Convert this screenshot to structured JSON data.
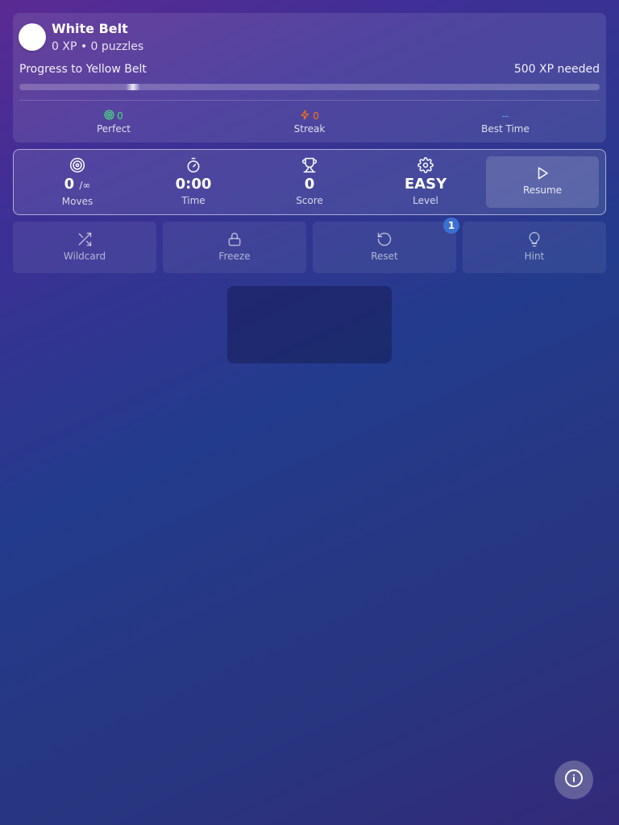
{
  "belt": {
    "title": "White Belt",
    "subtitle": "0 XP • 0 puzzles",
    "avatar_color": "#ffffff",
    "progress_label": "Progress to Yellow Belt",
    "progress_needed": "500 XP needed",
    "progress_fraction": 0
  },
  "belt_stats": {
    "perfect": {
      "value": "0",
      "label": "Perfect",
      "icon": "target-icon",
      "color": "#4ade80"
    },
    "streak": {
      "value": "0",
      "label": "Streak",
      "icon": "lightning-icon",
      "color": "#f97316"
    },
    "best_time": {
      "value": "--",
      "label": "Best Time",
      "color": "#60a5fa"
    }
  },
  "stats": {
    "moves": {
      "value": "0",
      "limit": "/∞",
      "label": "Moves",
      "icon": "target-icon"
    },
    "time": {
      "value": "0:00",
      "label": "Time",
      "icon": "stopwatch-icon"
    },
    "score": {
      "value": "0",
      "label": "Score",
      "icon": "trophy-icon"
    },
    "level": {
      "value": "EASY",
      "label": "Level",
      "icon": "gear-icon"
    },
    "resume": {
      "label": "Resume",
      "icon": "play-icon"
    }
  },
  "powerups": {
    "wildcard": {
      "label": "Wildcard",
      "icon": "shuffle-icon"
    },
    "freeze": {
      "label": "Freeze",
      "icon": "lock-icon"
    },
    "reset": {
      "label": "Reset",
      "icon": "reset-icon",
      "badge": "1",
      "badge_color": "#3b6fd0"
    },
    "hint": {
      "label": "Hint",
      "icon": "lightbulb-icon"
    }
  },
  "info_button": {
    "icon": "info-icon"
  }
}
